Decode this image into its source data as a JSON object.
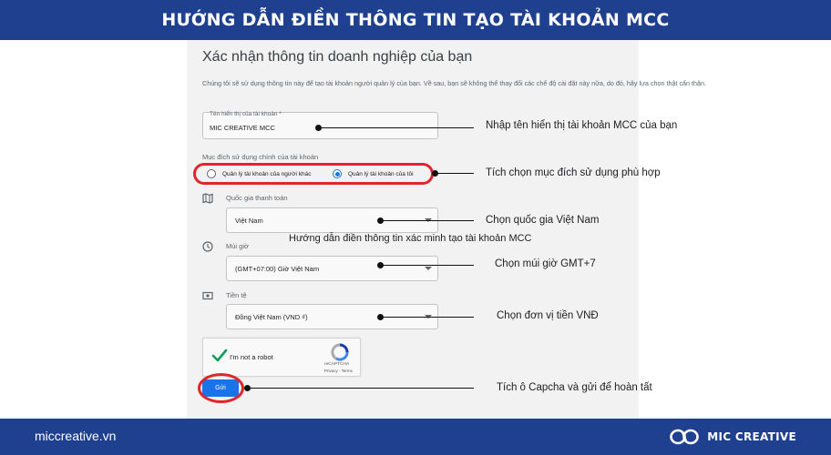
{
  "header": {
    "title": "HƯỚNG DẪN ĐIỀN THÔNG TIN TẠO TÀI KHOẢN MCC"
  },
  "footer": {
    "website": "miccreative.vn",
    "brand": "MIC CREATIVE"
  },
  "form": {
    "title": "Xác nhận thông tin doanh nghiệp của bạn",
    "description": "Chúng tôi sẽ sử dụng thông tin này để tạo tài khoản người quản lý của bạn. Về sau, bạn sẽ không thể thay đổi các chế độ cài đặt này nữa, do đó, hãy lựa chọn thật cẩn thận.",
    "account_name": {
      "label": "Tên hiển thị của tài khoản *",
      "value": "MIC CREATIVE MCC"
    },
    "purpose": {
      "label": "Mục đích sử dụng chính của tài khoản",
      "option_others": "Quản lý tài khoản của người khác",
      "option_mine": "Quản lý tài khoản của tôi",
      "selected": "option_mine"
    },
    "country": {
      "label": "Quốc gia thanh toán",
      "value": "Việt Nam"
    },
    "timezone": {
      "label": "Múi giờ",
      "value": "(GMT+07:00) Giờ Việt Nam"
    },
    "currency": {
      "label": "Tiền tệ",
      "value": "Đồng Việt Nam (VND ₫)"
    },
    "captcha": {
      "label": "I'm not a robot",
      "brand": "reCAPTCHA",
      "links": "Privacy - Terms"
    },
    "submit_label": "Gửi"
  },
  "caption": "Hướng dẫn điền thông tin  xác minh tạo tài khoản MCC",
  "annotations": {
    "name": "Nhập tên hiển thị tài khoản MCC của bạn",
    "purpose": "Tích chọn mục đích sử dụng phù hợp",
    "country": "Chọn quốc gia Việt Nam",
    "timezone": "Chọn múi giờ GMT+7",
    "currency": "Chọn đơn vị tiền VNĐ",
    "submit": "Tích ô Capcha và gửi để hoàn tất"
  },
  "colors": {
    "header_bg": "#1f3f8f",
    "accent_blue": "#1a73e8",
    "highlight_red": "#e0262b",
    "check_green": "#0f9d58"
  }
}
